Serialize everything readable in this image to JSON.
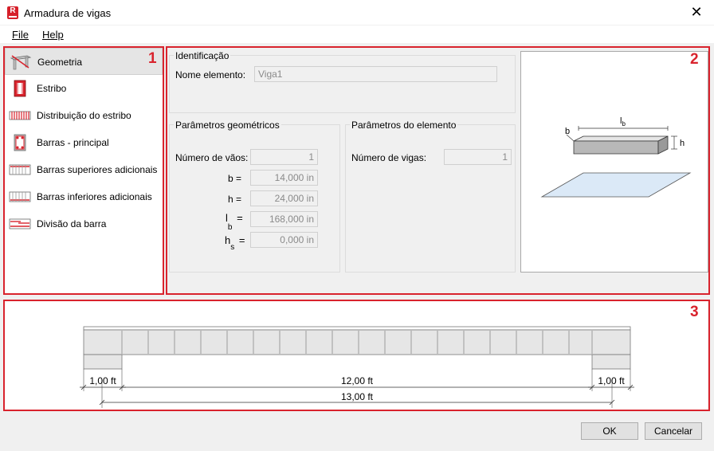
{
  "window": {
    "title": "Armadura de vigas",
    "app_icon_letter": "R"
  },
  "menu": {
    "file": "File",
    "help": "Help"
  },
  "callouts": [
    "1",
    "2",
    "3"
  ],
  "nav": {
    "items": [
      {
        "label": "Geometria",
        "icon": "beam-geometry-icon",
        "selected": true
      },
      {
        "label": "Estribo",
        "icon": "stirrup-icon"
      },
      {
        "label": "Distribuição do estribo",
        "icon": "stirrup-distribution-icon"
      },
      {
        "label": "Barras - principal",
        "icon": "main-bars-icon"
      },
      {
        "label": "Barras superiores adicionais",
        "icon": "top-bars-icon"
      },
      {
        "label": "Barras inferiores adicionais",
        "icon": "bottom-bars-icon"
      },
      {
        "label": "Divisão da barra",
        "icon": "bar-split-icon"
      }
    ]
  },
  "identification": {
    "title": "Identificação",
    "name_label": "Nome elemento:",
    "name_placeholder": "Viga1"
  },
  "geometry": {
    "title": "Parâmetros geométricos",
    "spans_label": "Número de vãos:",
    "spans_value": "1",
    "b_label": "b =",
    "b_value": "14,000 in",
    "h_label": "h =",
    "h_value": "24,000 in",
    "lb_label": "l",
    "lb_sub": "b",
    "lb_eq": "=",
    "lb_value": "168,000 in",
    "hs_label": "h",
    "hs_sub": "s",
    "hs_eq": "=",
    "hs_value": "0,000 in"
  },
  "element": {
    "title": "Parâmetros do elemento",
    "beams_label": "Número de vigas:",
    "beams_value": "1"
  },
  "preview": {
    "b": "b",
    "h": "h",
    "lb": "l",
    "lb_sub": "b"
  },
  "elevation": {
    "dims": {
      "left": "1,00 ft",
      "middle": "12,00 ft",
      "right": "1,00 ft",
      "total": "13,00 ft"
    }
  },
  "buttons": {
    "ok": "OK",
    "cancel": "Cancelar"
  },
  "colors": {
    "accent_red": "#d9232d",
    "slab_blue": "#dbe9f7"
  }
}
